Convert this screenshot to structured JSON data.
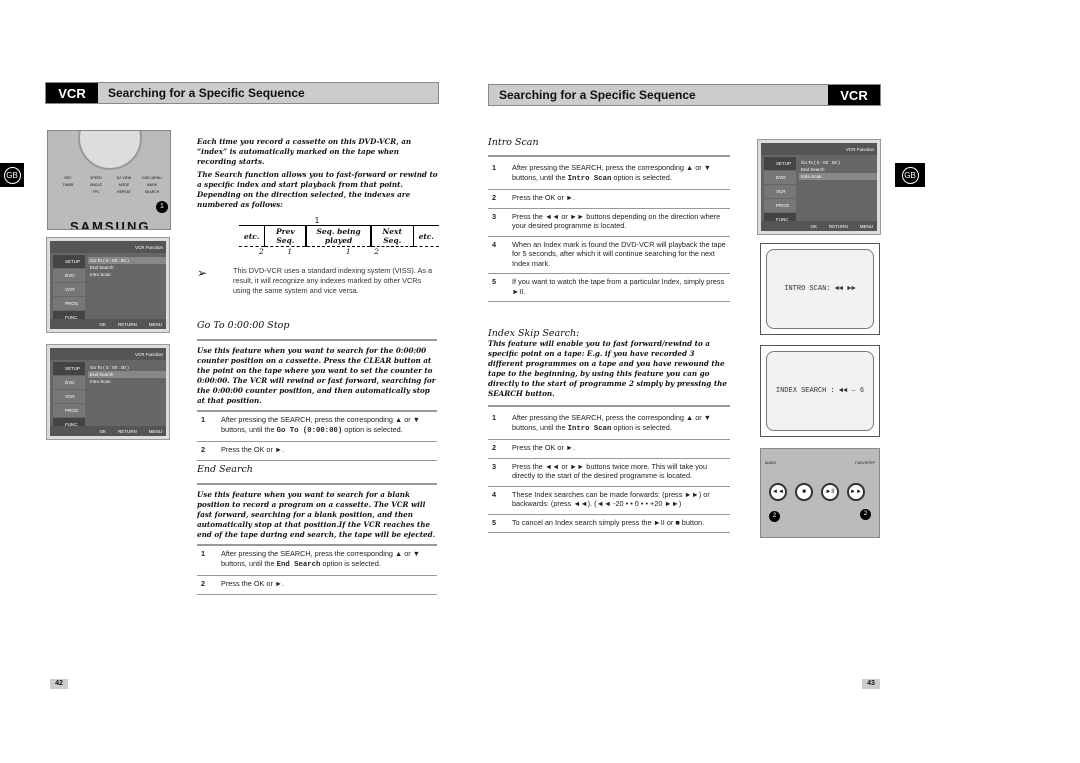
{
  "left": {
    "tag": "VCR",
    "title": "Searching for a Specific Sequence",
    "gb": "GB",
    "page": "42",
    "intro": [
      "Each time you record a cassette on this DVD-VCR, an “index” is automatically marked on the tape when recording starts.",
      "The Search function allows you to fast-forward or rewind to a specific index and start playback from that point. Depending on the direction selected, the indexes are numbered as follows:"
    ],
    "diagram": {
      "arrow": "1",
      "cells": [
        "etc.",
        "Prev Seq.",
        "Seq. being played",
        "Next Seq.",
        "etc."
      ],
      "numbers": [
        "2",
        "1",
        "1",
        "2"
      ]
    },
    "note": "This DVD-VCR uses a standard indexing system (VISS). As a result, it will recognize any indexes marked by other VCRs using the same system and vice versa.",
    "goto": {
      "title": "Go To 0:00:00 Stop",
      "desc": "Use this feature when you want to search for the 0:00:00 counter position on a cassette. Press the CLEAR button at the point on the tape where you want to set the counter to 0:00:00. The VCR will rewind or fast forward, searching for the 0:00:00 counter position, and then automatically stop at that position.",
      "steps": [
        {
          "n": "1",
          "pre": "After pressing the SEARCH, press the corresponding ▲ or ▼ buttons, until the ",
          "code": "Go To (0:00:00)",
          "post": " option is selected."
        },
        {
          "n": "2",
          "text": "Press the OK or ►."
        }
      ]
    },
    "end": {
      "title": "End Search",
      "desc": "Use this feature when you want to search for a blank position to record a program on a cassette. The VCR will fast forward, searching for a blank position, and then automatically stop at that position.If the VCR reaches the end of the tape during end search, the tape will be ejected.",
      "steps": [
        {
          "n": "1",
          "pre": "After pressing the SEARCH, press the corresponding ▲ or ▼ buttons, until the ",
          "code": "End Search",
          "post": " option is selected."
        },
        {
          "n": "2",
          "text": "Press the OK or ►."
        }
      ]
    },
    "remote": {
      "brand": "SAMSUNG",
      "buttons": [
        "REC",
        "SPEED",
        "EZ VIEW",
        "DISC MENU",
        "TIMER",
        "ANGLE",
        "MODE",
        "MARK",
        "TPC",
        "REPEAT",
        "SEARCH"
      ],
      "callout": "1"
    }
  },
  "menu": {
    "header": "VCR Function",
    "side": [
      "SETUP",
      "DVD",
      "VCR",
      "PROG",
      "FUNC"
    ],
    "options": [
      "Go To ( 0 : 00 : 00 )",
      "End Search",
      "Intro Scan"
    ],
    "bottom": [
      "OK",
      "RETURN",
      "MENU"
    ]
  },
  "right": {
    "tag": "VCR",
    "title": "Searching for a Specific Sequence",
    "gb": "GB",
    "page": "43",
    "intro_scan": {
      "title": "Intro Scan",
      "steps": [
        {
          "n": "1",
          "pre": "After pressing the SEARCH, press the corresponding ▲ or ▼ buttons, until the ",
          "code": "Intro Scan",
          "post": " option is selected."
        },
        {
          "n": "2",
          "text": "Press the OK or ►."
        },
        {
          "n": "3",
          "text": "Press the ◄◄ or ►► buttons depending on the direction where your desired programme is located."
        },
        {
          "n": "4",
          "text": "When an Index mark is found the DVD-VCR will playback the tape for 5 seconds, after which it will continue searching for the next Index mark."
        },
        {
          "n": "5",
          "text": "If you want to watch the tape from a particular Index, simply press ►II."
        }
      ]
    },
    "index_skip": {
      "title": "Index Skip Search:",
      "desc": "This feature will enable you to fast forward/rewind to a specific point on a tape: E.g. if you have recorded 3 different programmes on a tape and you have rewound the tape to the beginning, by using this feature you can go directly to the start of programme 2 simply by pressing the SEARCH button.",
      "steps": [
        {
          "n": "1",
          "pre": "After pressing the SEARCH, press the corresponding ▲ or ▼ buttons, until the ",
          "code": "Intro Scan",
          "post": " option is selected."
        },
        {
          "n": "2",
          "text": "Press the OK or ►."
        },
        {
          "n": "3",
          "text": "Press the ◄◄ or ►► buttons twice more. This will take you directly to the start of the desired programme is located."
        },
        {
          "n": "4",
          "text": "These Index searches can be made forwards: (press ►►) or backwards: (press ◄◄). (◄◄ -20 • • 0 • • +20 ►►)"
        },
        {
          "n": "5",
          "text": "To cancel an Index search simply press the ►II or ■ button."
        }
      ]
    },
    "tv1": "INTRO SCAN:  ◄◄ ►►",
    "tv2": "INDEX SEARCH : ◄◄ – 6",
    "remote": {
      "labels": [
        "AUDIO",
        "F.ADV/STEP"
      ],
      "callouts": [
        "2",
        "2"
      ]
    }
  }
}
